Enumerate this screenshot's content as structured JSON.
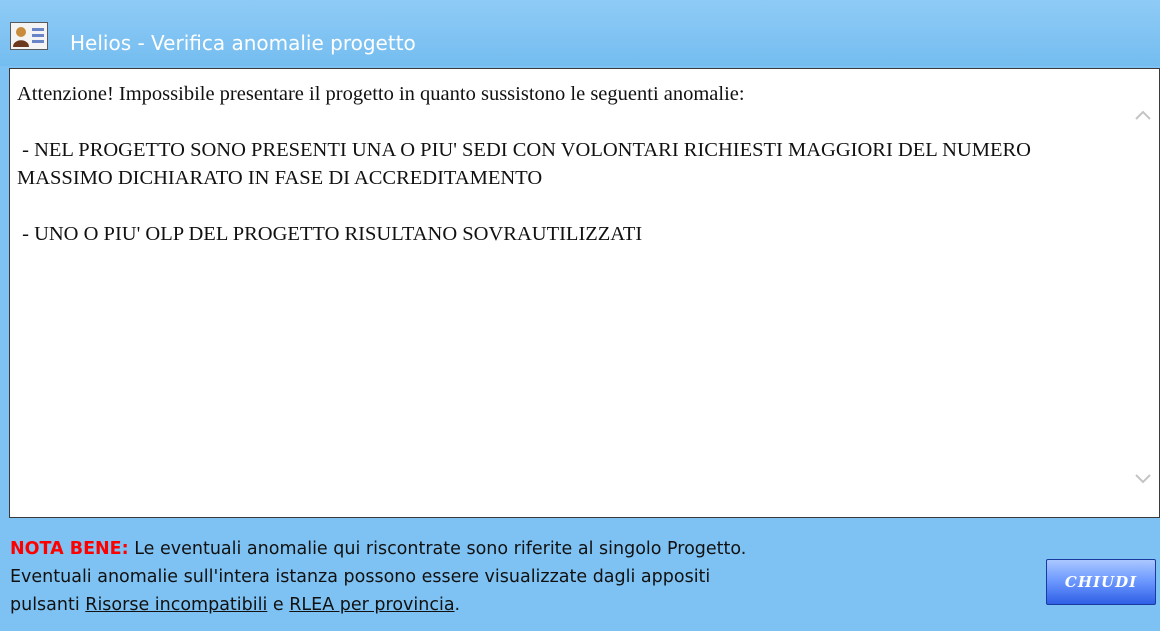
{
  "window": {
    "title": "Helios - Verifica anomalie progetto",
    "icon": "contact-card-icon"
  },
  "message": {
    "intro": "Attenzione! Impossibile presentare il progetto in quanto sussistono le seguenti anomalie:",
    "anomalies": [
      " - NEL PROGETTO SONO PRESENTI UNA O PIU' SEDI CON VOLONTARI RICHIESTI MAGGIORI DEL NUMERO MASSIMO DICHIARATO IN FASE DI ACCREDITAMENTO",
      " - UNO O PIU' OLP DEL PROGETTO RISULTANO SOVRAUTILIZZATI"
    ]
  },
  "scrollbar": {
    "up_icon": "chevron-up-icon",
    "down_icon": "chevron-down-icon"
  },
  "note": {
    "label": "NOTA BENE:",
    "line1": " Le eventuali anomalie qui riscontrate sono riferite al singolo Progetto.",
    "line2": "Eventuali anomalie sull'intera istanza possono essere visualizzate dagli appositi",
    "line3_prefix": "pulsanti ",
    "link1": "Risorse incompatibili",
    "connector": " e ",
    "link2": "RLEA per provincia",
    "suffix": "."
  },
  "buttons": {
    "close_label": "CHIUDI"
  },
  "colors": {
    "background": "#7ec2f3",
    "note_label": "#ff0000",
    "button_blue": "#2f5fe6"
  }
}
